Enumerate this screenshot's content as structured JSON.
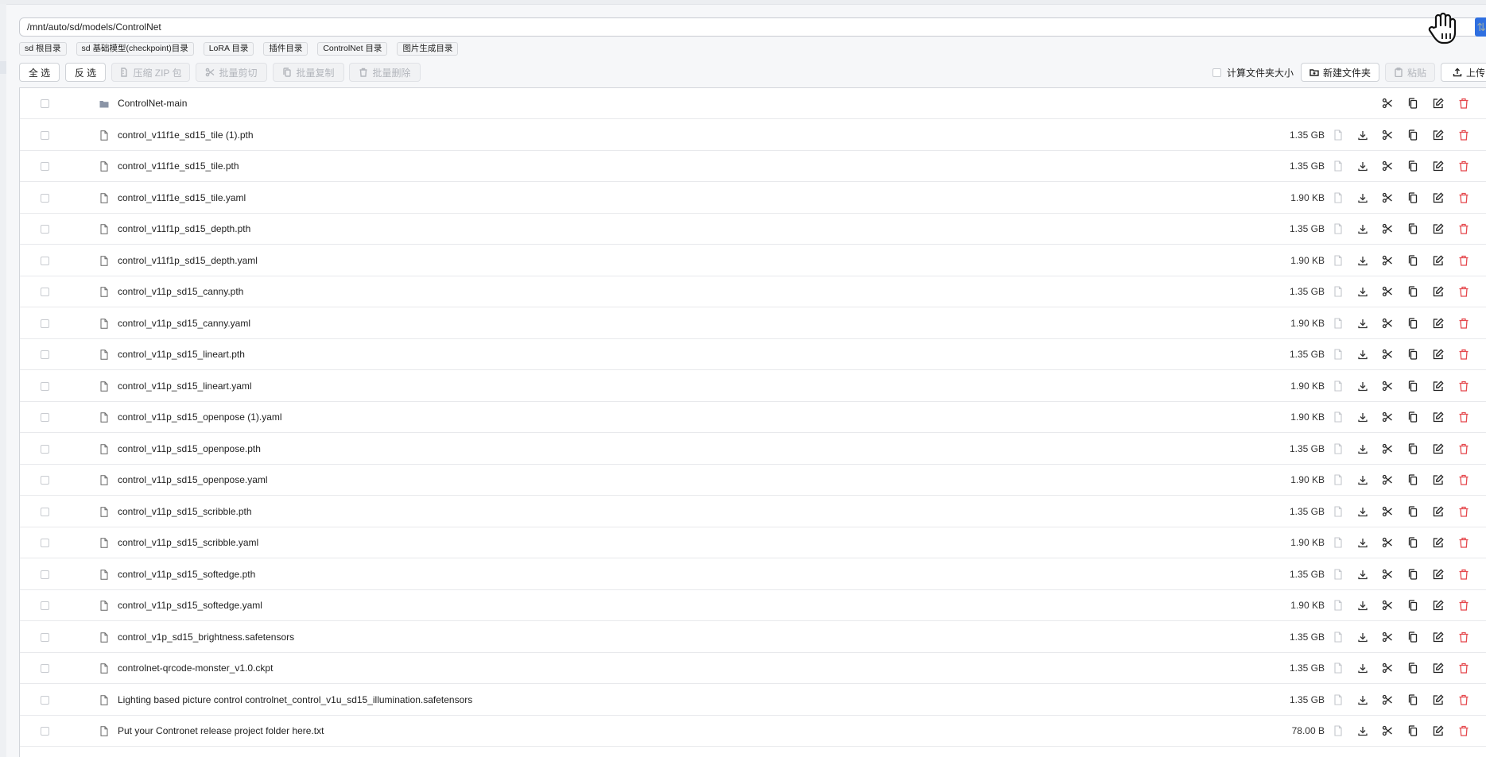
{
  "path_bar": {
    "value": "/mnt/auto/sd/models/ControlNet"
  },
  "shortcuts": [
    "sd 根目录",
    "sd 基础模型(checkpoint)目录",
    "LoRA 目录",
    "插件目录",
    "ControlNet 目录",
    "图片生成目录"
  ],
  "toolbar": {
    "select_all": "全 选",
    "invert": "反 选",
    "zip": "压缩 ZIP 包",
    "batch_cut": "批量剪切",
    "batch_copy": "批量复制",
    "batch_delete": "批量删除",
    "calc_folder_size": "计算文件夹大小",
    "new_folder": "新建文件夹",
    "paste": "粘贴",
    "upload": "上传"
  },
  "colors": {
    "accent": "#2f6fe0",
    "delete": "#e5484d",
    "folder": "#8a94a6"
  },
  "files": [
    {
      "name": "ControlNet-main",
      "size": "",
      "type": "folder"
    },
    {
      "name": "control_v11f1e_sd15_tile (1).pth",
      "size": "1.35 GB",
      "type": "file"
    },
    {
      "name": "control_v11f1e_sd15_tile.pth",
      "size": "1.35 GB",
      "type": "file"
    },
    {
      "name": "control_v11f1e_sd15_tile.yaml",
      "size": "1.90 KB",
      "type": "file"
    },
    {
      "name": "control_v11f1p_sd15_depth.pth",
      "size": "1.35 GB",
      "type": "file"
    },
    {
      "name": "control_v11f1p_sd15_depth.yaml",
      "size": "1.90 KB",
      "type": "file"
    },
    {
      "name": "control_v11p_sd15_canny.pth",
      "size": "1.35 GB",
      "type": "file"
    },
    {
      "name": "control_v11p_sd15_canny.yaml",
      "size": "1.90 KB",
      "type": "file"
    },
    {
      "name": "control_v11p_sd15_lineart.pth",
      "size": "1.35 GB",
      "type": "file"
    },
    {
      "name": "control_v11p_sd15_lineart.yaml",
      "size": "1.90 KB",
      "type": "file"
    },
    {
      "name": "control_v11p_sd15_openpose (1).yaml",
      "size": "1.90 KB",
      "type": "file"
    },
    {
      "name": "control_v11p_sd15_openpose.pth",
      "size": "1.35 GB",
      "type": "file"
    },
    {
      "name": "control_v11p_sd15_openpose.yaml",
      "size": "1.90 KB",
      "type": "file"
    },
    {
      "name": "control_v11p_sd15_scribble.pth",
      "size": "1.35 GB",
      "type": "file"
    },
    {
      "name": "control_v11p_sd15_scribble.yaml",
      "size": "1.90 KB",
      "type": "file"
    },
    {
      "name": "control_v11p_sd15_softedge.pth",
      "size": "1.35 GB",
      "type": "file"
    },
    {
      "name": "control_v11p_sd15_softedge.yaml",
      "size": "1.90 KB",
      "type": "file"
    },
    {
      "name": "control_v1p_sd15_brightness.safetensors",
      "size": "1.35 GB",
      "type": "file"
    },
    {
      "name": "controlnet-qrcode-monster_v1.0.ckpt",
      "size": "1.35 GB",
      "type": "file"
    },
    {
      "name": "Lighting based picture control controlnet_control_v1u_sd15_illumination.safetensors",
      "size": "1.35 GB",
      "type": "file"
    },
    {
      "name": "Put your Contronet release project folder here.txt",
      "size": "78.00 B",
      "type": "file"
    }
  ]
}
